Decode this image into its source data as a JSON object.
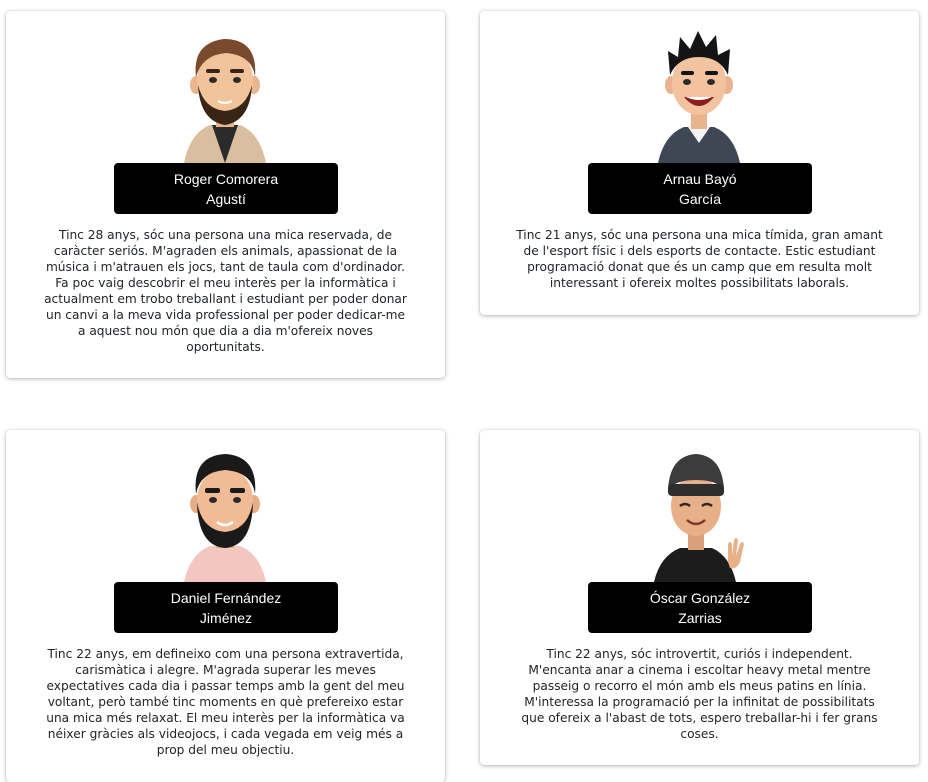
{
  "team": [
    {
      "name_line1": "Roger Comorera",
      "name_line2": "Agustí",
      "avatar_icon": "bearded-man-avatar-icon",
      "bio": "Tinc 28 anys, sóc una persona una mica reservada, de caràcter seriós. M'agraden els animals, apassionat de la música i m'atrauen els jocs, tant de taula com d'ordinador. Fa poc vaig descobrir el meu interès per la informàtica i actualment em trobo treballant i estudiant per poder donar un canvi a la meva vida professional per poder dedicar-me a aquest nou món que dia a dia m'ofereix noves oportunitats."
    },
    {
      "name_line1": "Arnau Bayó",
      "name_line2": "García",
      "avatar_icon": "smiling-man-avatar-icon",
      "bio": "Tinc 21 anys, sóc una persona una mica tímida, gran amant de l'esport físic i dels esports de contacte. Estic estudiant programació donat que és un camp que em resulta molt interessant i ofereix moltes possibilitats laborals."
    },
    {
      "name_line1": "Daniel Fernández",
      "name_line2": "Jiménez",
      "avatar_icon": "bearded-man-avatar-icon",
      "bio": "Tinc 22 anys, em defineixo com una persona extravertida, carismàtica i alegre. M'agrada superar les meves expectatives cada dia i passar temps amb la gent del meu voltant, però també tinc moments en què prefereixo estar una mica més relaxat. El meu interès per la informàtica va néixer gràcies als videojocs, i cada vegada em veig més a prop del meu objectiu."
    },
    {
      "name_line1": "Óscar González",
      "name_line2": "Zarrias",
      "avatar_icon": "beanie-waving-avatar-icon",
      "bio": "Tinc 22 anys, sóc introvertit, curiós i independent. M'encanta anar a cinema i escoltar heavy metal mentre passeig o recorro el món amb els meus patins en línia. M'interessa la programació per la infinitat de possibilitats que ofereix a l'abast de tots, espero treballar-hi i fer grans coses."
    }
  ],
  "colors": {
    "name_box_bg": "#000000",
    "name_box_text": "#ffffff",
    "bio_text": "#212529"
  }
}
